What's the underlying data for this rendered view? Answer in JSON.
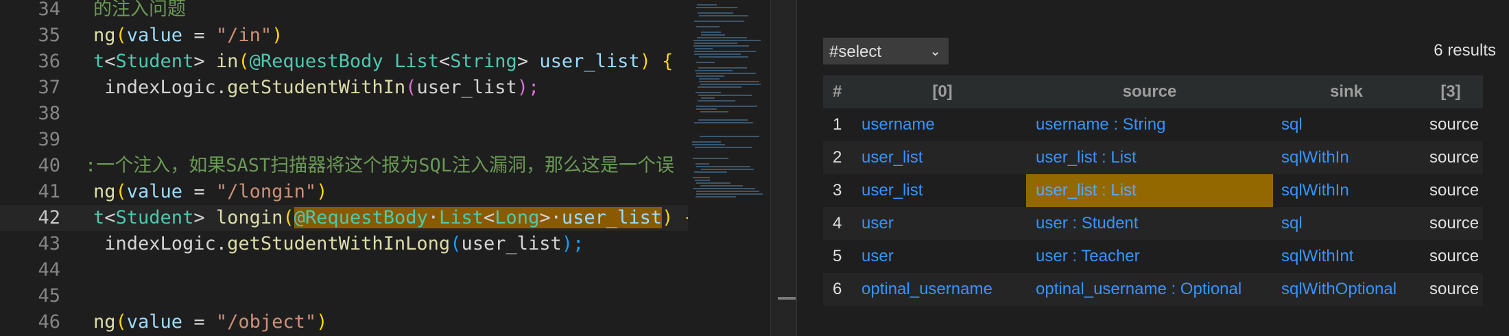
{
  "editor": {
    "line_numbers": [
      "34",
      "35",
      "36",
      "37",
      "38",
      "39",
      "40",
      "41",
      "42",
      "43",
      "44",
      "45",
      "46"
    ],
    "current_line": "42",
    "lines": {
      "l34": {
        "comment": "的注入问题"
      },
      "l35": {
        "a": "ng",
        "b": "(",
        "c": "value",
        "d": " = ",
        "e": "\"/in\"",
        "f": ")"
      },
      "l36": {
        "a": "t",
        "b": "<",
        "c": "Student",
        "d": "> ",
        "e": "in",
        "f": "(",
        "g": "@RequestBody",
        "h": " ",
        "i": "List",
        "j": "<",
        "k": "String",
        "l": "> ",
        "m": "user_list",
        "n": ")",
        "o": " {"
      },
      "l37": {
        "a": " indexLogic.",
        "b": "getStudentWithIn",
        "c": "(",
        "d": "user_list",
        "e": ");"
      },
      "l40": {
        "comment": ":一个注入，如果SAST扫描器将这个报为SQL注入漏洞，那么这是一个误"
      },
      "l41": {
        "a": "ng",
        "b": "(",
        "c": "value",
        "d": " = ",
        "e": "\"/longin\"",
        "f": ")"
      },
      "l42": {
        "a": "t",
        "b": "<",
        "c": "Student",
        "d": "> ",
        "e": "longin",
        "f": "(",
        "g": "@RequestBody",
        "h": "·",
        "i": "List",
        "j": "<",
        "k": "Long",
        "l": ">·",
        "m": "user_list",
        "n": ")",
        "o": " {"
      },
      "l43": {
        "a": " indexLogic.",
        "b": "getStudentWithInLong",
        "c": "(",
        "d": "user_list",
        "e": ");"
      },
      "l46": {
        "a": "ng",
        "b": "(",
        "c": "value",
        "d": " = ",
        "e": "\"/object\"",
        "f": ")"
      }
    }
  },
  "results": {
    "query": "#select",
    "count": "6 results",
    "headers": [
      "#",
      "[0]",
      "source",
      "sink",
      "[3]"
    ],
    "rows": [
      {
        "n": "1",
        "c0": "username",
        "source": "username : String",
        "sink": "sql",
        "c3": "source"
      },
      {
        "n": "2",
        "c0": "user_list",
        "source": "user_list : List",
        "sink": "sqlWithIn",
        "c3": "source"
      },
      {
        "n": "3",
        "c0": "user_list",
        "source": "user_list : List",
        "sink": "sqlWithIn",
        "c3": "source"
      },
      {
        "n": "4",
        "c0": "user",
        "source": "user : Student",
        "sink": "sql",
        "c3": "source"
      },
      {
        "n": "5",
        "c0": "user",
        "source": "user : Teacher",
        "sink": "sqlWithInt",
        "c3": "source"
      },
      {
        "n": "6",
        "c0": "optinal_username",
        "source": "optinal_username : Optional",
        "sink": "sqlWithOptional",
        "c3": "source"
      }
    ]
  },
  "colors": {
    "selection": "#946800",
    "link": "#3794ff",
    "background": "#1e1e1e"
  }
}
